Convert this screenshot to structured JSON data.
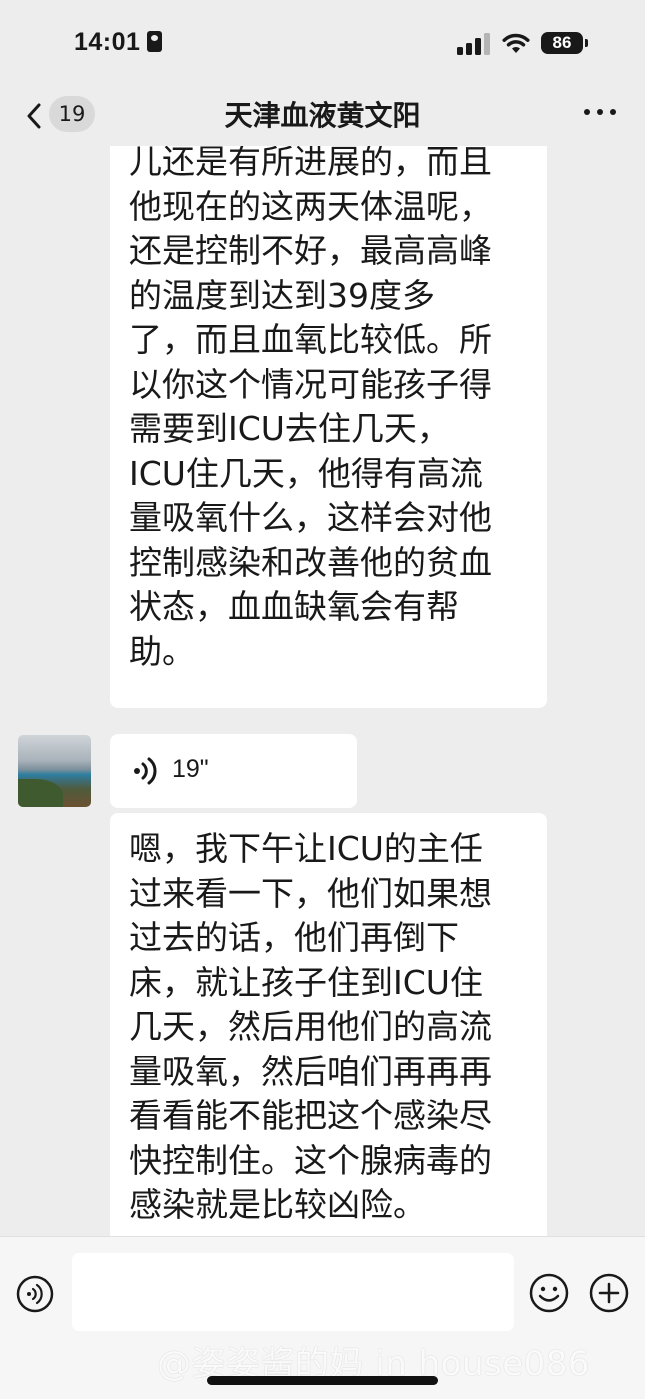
{
  "status_bar": {
    "time": "14:01",
    "battery": "86"
  },
  "nav": {
    "back_count": "19",
    "title": "天津血液黄文阳"
  },
  "messages": [
    {
      "type": "text",
      "text": "儿还是有所进展的，而且\n他现在的这两天体温呢，\n还是控制不好，最高高峰\n的温度到达到39度多\n了，而且血氧比较低。所\n以你这个情况可能孩子得\n需要到ICU去住几天，\nICU住几天，他得有高流\n量吸氧什么，这样会对他\n控制感染和改善他的贫血\n状态，血血缺氧会有帮\n助。"
    },
    {
      "type": "voice",
      "duration": "19\""
    },
    {
      "type": "text",
      "text": "嗯，我下午让ICU的主任\n过来看一下，他们如果想\n过去的话，他们再倒下\n床，就让孩子住到ICU住\n几天，然后用他们的高流\n量吸氧，然后咱们再再再\n看看能不能把这个感染尽\n快控制住。这个腺病毒的\n感染就是比较凶险。"
    }
  ],
  "input_bar": {
    "value": ""
  },
  "watermark": "@姿姿酱的妈 in house086",
  "icons": [
    "id-card-icon",
    "signal-icon",
    "wifi-icon",
    "battery-icon",
    "back-chevron-icon",
    "more-icon",
    "voice-wave-icon",
    "voice-toggle-icon",
    "emoji-icon",
    "plus-icon"
  ]
}
